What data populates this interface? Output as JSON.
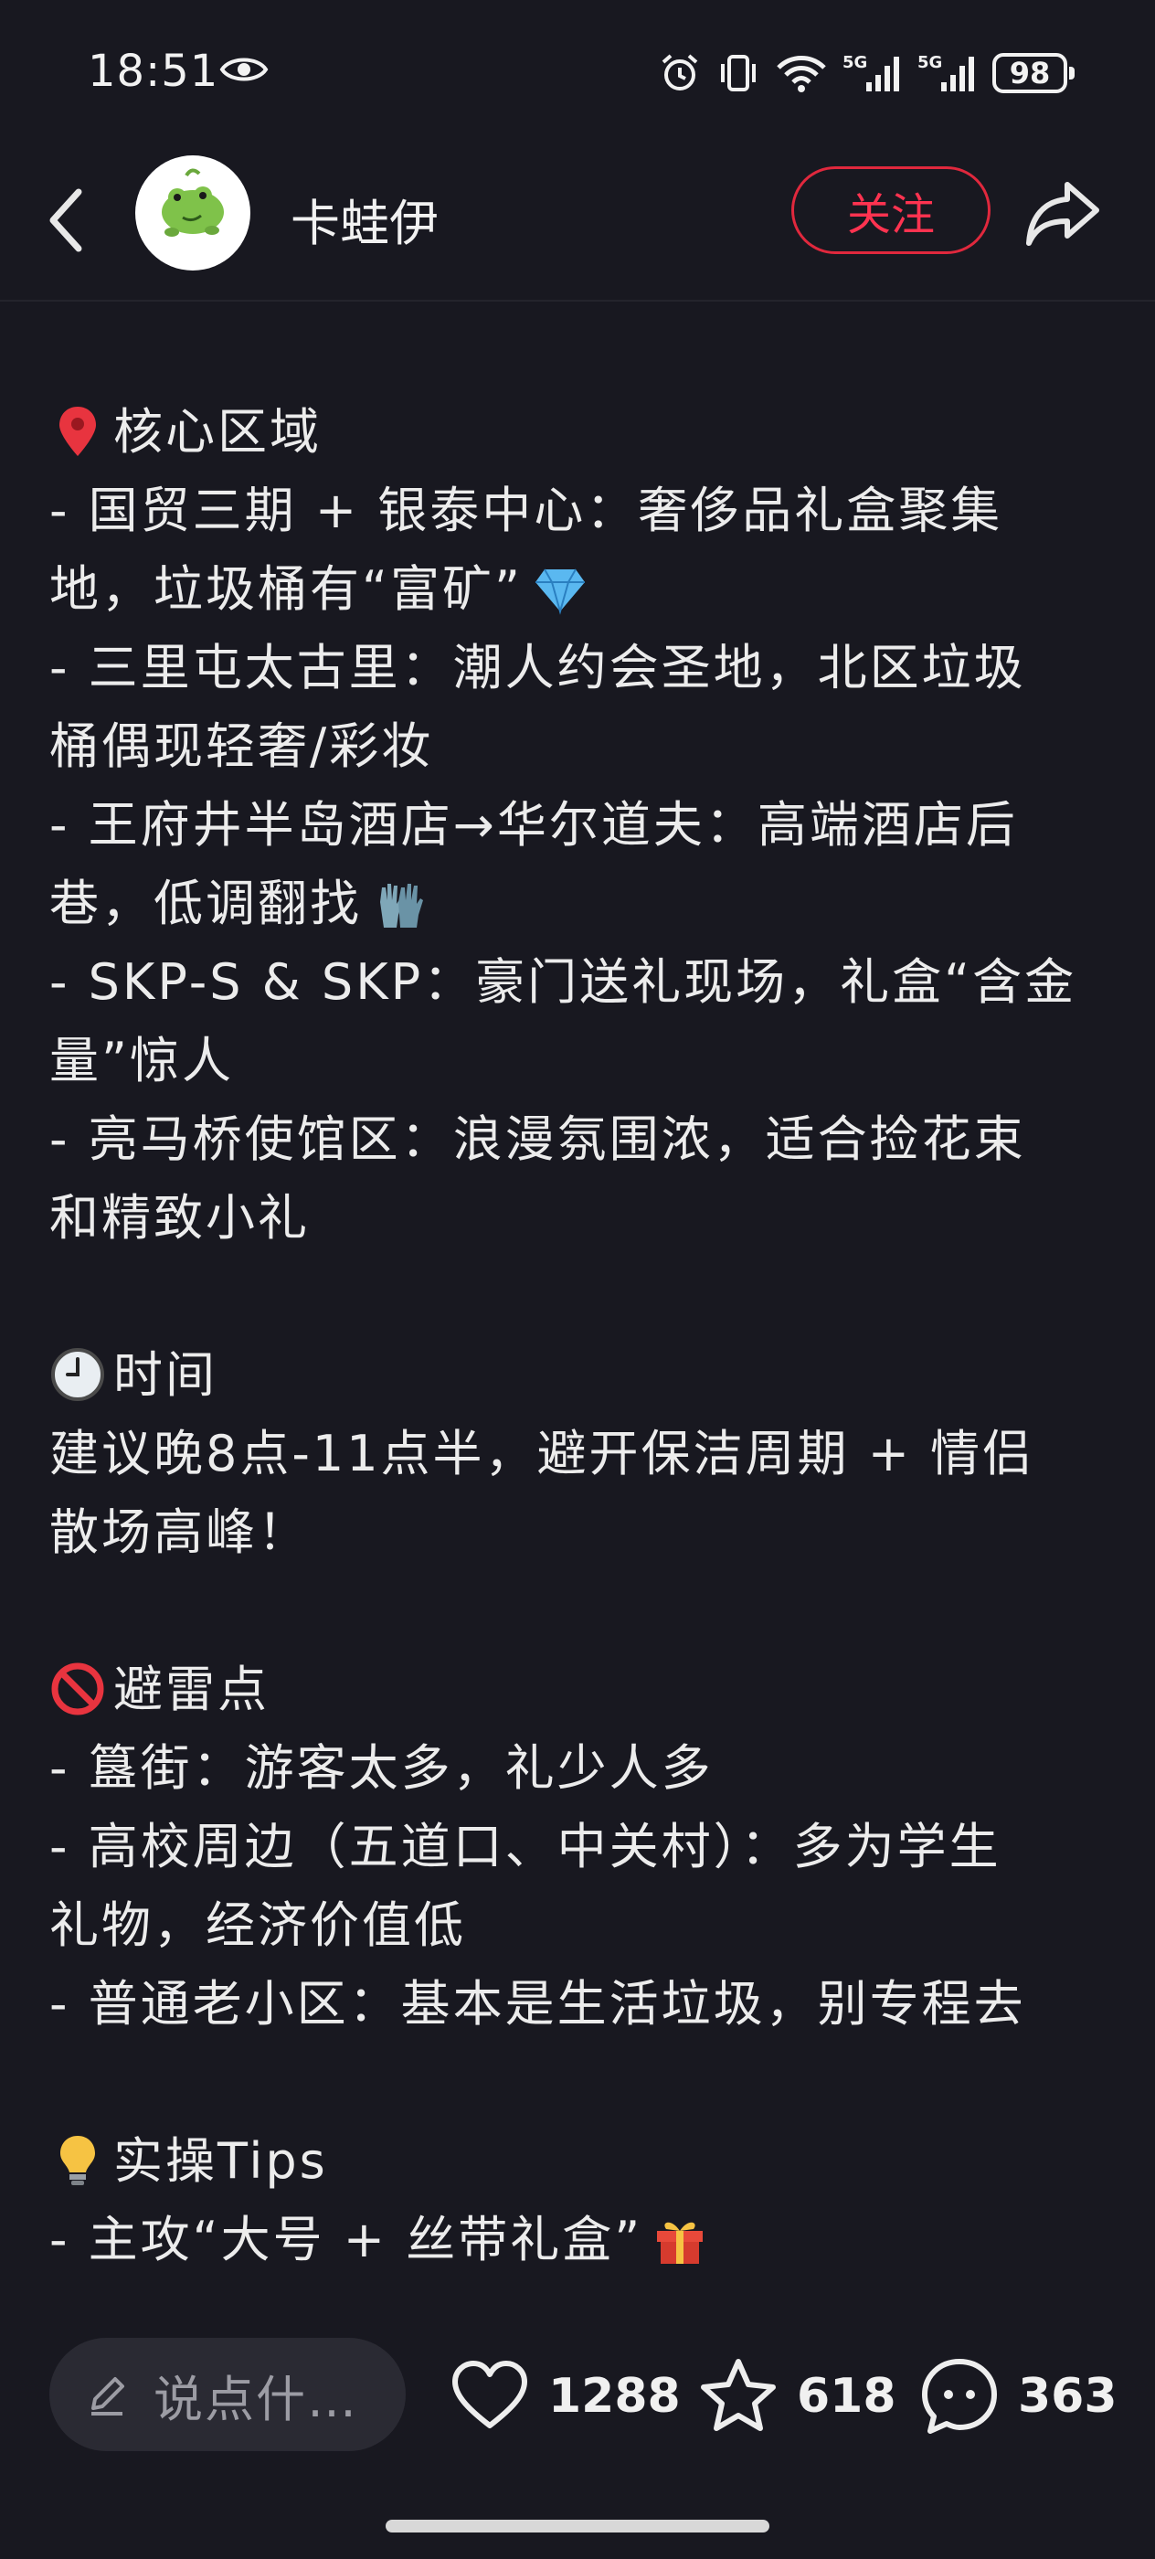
{
  "status_bar": {
    "time": "18:51",
    "icons": [
      "eye-icon",
      "alarm-icon",
      "vibrate-icon",
      "wifi-icon",
      "signal-5g-icon",
      "signal-5g-icon"
    ],
    "battery": "98"
  },
  "header": {
    "back_icon": "chevron-left-icon",
    "author": "卡蛙伊",
    "follow_label": "关注",
    "share_icon": "share-arrow-icon"
  },
  "content": {
    "lines": [
      {
        "emoji": "pin-icon",
        "text": "核心区域"
      },
      {
        "text": "- 国贸三期 + 银泰中心：奢侈品礼盒聚集"
      },
      {
        "text": "地，垃圾桶有“富矿”",
        "trail_emoji": "diamond-icon"
      },
      {
        "text": "- 三里屯太古里：潮人约会圣地，北区垃圾"
      },
      {
        "text": "桶偶现轻奢/彩妆"
      },
      {
        "text": "- 王府井半岛酒店→华尔道夫：高端酒店后"
      },
      {
        "text": "巷，低调翻找",
        "trail_emoji": "gloves-icon"
      },
      {
        "text": "- SKP-S & SKP：豪门送礼现场，礼盒“含金"
      },
      {
        "text": "量”惊人"
      },
      {
        "text": "- 亮马桥使馆区：浪漫氛围浓，适合捡花束"
      },
      {
        "text": "和精致小礼"
      },
      {
        "text": ""
      },
      {
        "emoji": "clock-icon",
        "text": "时间"
      },
      {
        "text": "建议晚8点-11点半，避开保洁周期 + 情侣"
      },
      {
        "text": "散场高峰！"
      },
      {
        "text": ""
      },
      {
        "emoji": "no-entry-icon",
        "text": "避雷点"
      },
      {
        "text": "- 簋街：游客太多，礼少人多"
      },
      {
        "text": "- 高校周边（五道口、中关村）：多为学生"
      },
      {
        "text": "礼物，经济价值低"
      },
      {
        "text": "- 普通老小区：基本是生活垃圾，别专程去"
      },
      {
        "text": ""
      },
      {
        "emoji": "bulb-icon",
        "text": "实操Tips"
      },
      {
        "text": "- 主攻“大号 + 丝带礼盒”",
        "trail_emoji": "gift-icon"
      }
    ]
  },
  "bottom_bar": {
    "comment_placeholder": "说点什…",
    "likes": "1288",
    "favorites": "618",
    "comments": "363"
  },
  "colors": {
    "background": "#181820",
    "follow_red": "#e0283d",
    "text": "#ececec"
  }
}
